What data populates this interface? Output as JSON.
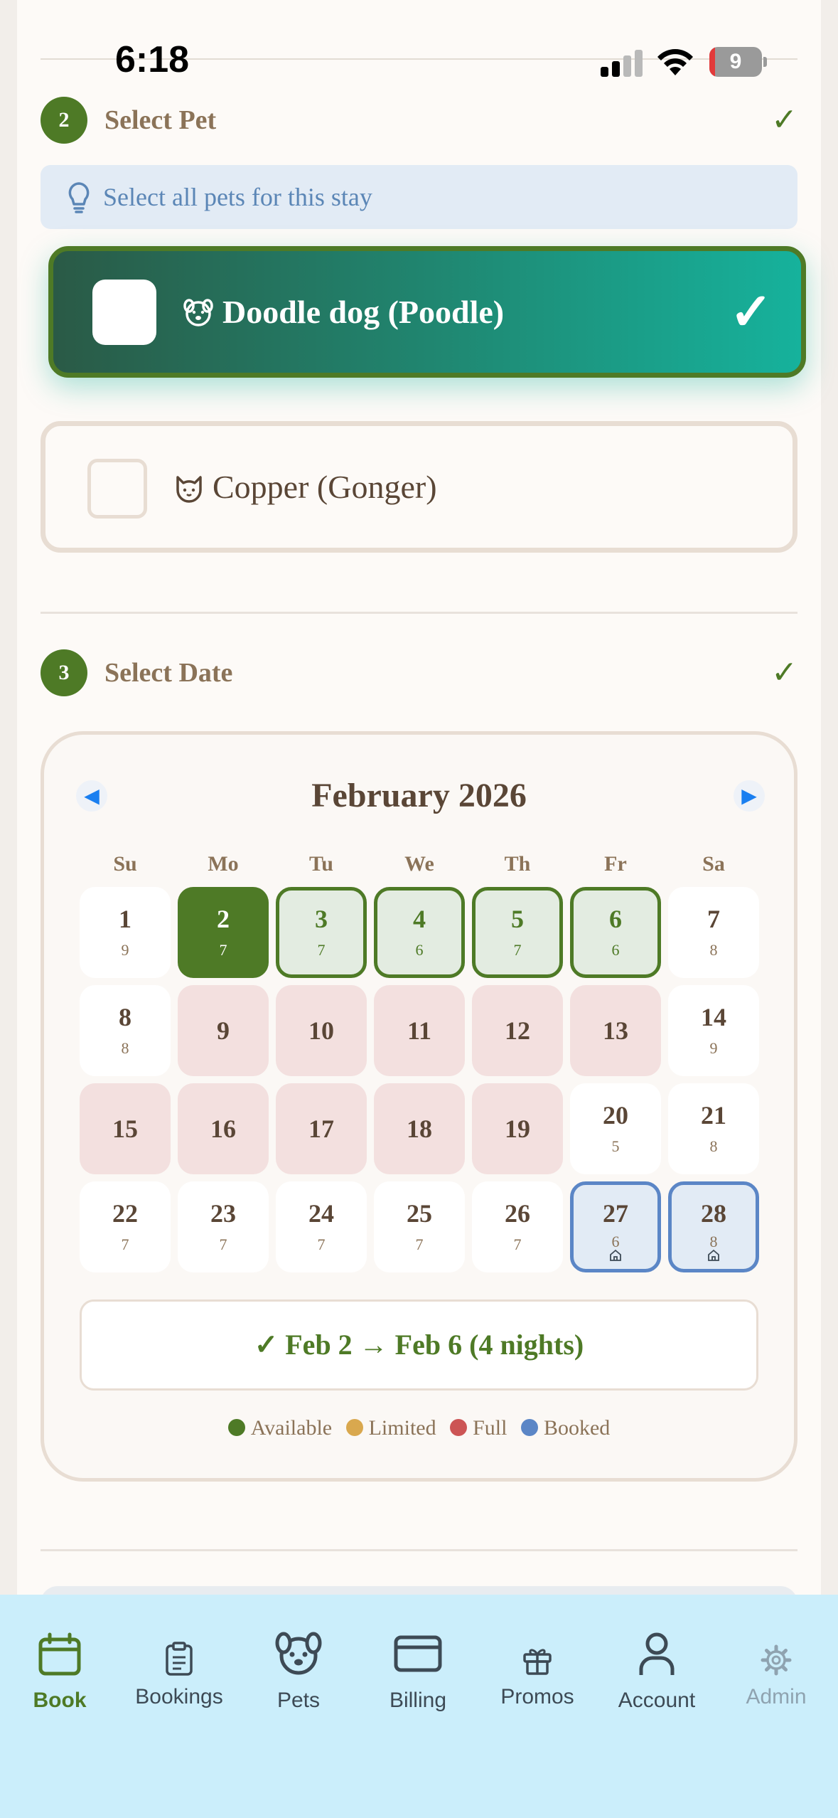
{
  "status_bar": {
    "time": "6:18",
    "battery": "9"
  },
  "pet_section": {
    "step": "2",
    "title": "Select Pet",
    "check": "✓",
    "hint": "Select all pets for this stay",
    "pets": [
      {
        "name": "Doodle dog (Poodle)",
        "kind": "dog-icon",
        "selected": true,
        "tick": "✓"
      },
      {
        "name": "Copper (Gonger)",
        "kind": "cat-icon",
        "selected": false
      }
    ]
  },
  "date_section": {
    "step": "3",
    "title": "Select Date",
    "check": "✓"
  },
  "calendar": {
    "prev": "◀",
    "next": "▶",
    "month": "February 2026",
    "weekdays": [
      "Su",
      "Mo",
      "Tu",
      "We",
      "Th",
      "Fr",
      "Sa"
    ],
    "weeks": [
      [
        {
          "day": "1",
          "count": "9",
          "state": "available"
        },
        {
          "day": "2",
          "count": "7",
          "state": "selected-start"
        },
        {
          "day": "3",
          "count": "7",
          "state": "in-range"
        },
        {
          "day": "4",
          "count": "6",
          "state": "in-range"
        },
        {
          "day": "5",
          "count": "7",
          "state": "in-range"
        },
        {
          "day": "6",
          "count": "6",
          "state": "in-range"
        },
        {
          "day": "7",
          "count": "8",
          "state": "available"
        }
      ],
      [
        {
          "day": "8",
          "count": "8",
          "state": "available"
        },
        {
          "day": "9",
          "count": "",
          "state": "full"
        },
        {
          "day": "10",
          "count": "",
          "state": "full"
        },
        {
          "day": "11",
          "count": "",
          "state": "full"
        },
        {
          "day": "12",
          "count": "",
          "state": "full"
        },
        {
          "day": "13",
          "count": "",
          "state": "full"
        },
        {
          "day": "14",
          "count": "9",
          "state": "available"
        }
      ],
      [
        {
          "day": "15",
          "count": "",
          "state": "full"
        },
        {
          "day": "16",
          "count": "",
          "state": "full"
        },
        {
          "day": "17",
          "count": "",
          "state": "full"
        },
        {
          "day": "18",
          "count": "",
          "state": "full"
        },
        {
          "day": "19",
          "count": "",
          "state": "full"
        },
        {
          "day": "20",
          "count": "5",
          "state": "available"
        },
        {
          "day": "21",
          "count": "8",
          "state": "available"
        }
      ],
      [
        {
          "day": "22",
          "count": "7",
          "state": "available"
        },
        {
          "day": "23",
          "count": "7",
          "state": "available"
        },
        {
          "day": "24",
          "count": "7",
          "state": "available"
        },
        {
          "day": "25",
          "count": "7",
          "state": "available"
        },
        {
          "day": "26",
          "count": "7",
          "state": "available"
        },
        {
          "day": "27",
          "count": "6",
          "state": "booked"
        },
        {
          "day": "28",
          "count": "8",
          "state": "booked"
        }
      ]
    ],
    "range_summary": "✓ Feb 2 → Feb 6 (4 nights)",
    "legend": [
      {
        "label": "Available",
        "color": "#4e7a26"
      },
      {
        "label": "Limited",
        "color": "#d9a84e"
      },
      {
        "label": "Full",
        "color": "#cc5555"
      },
      {
        "label": "Booked",
        "color": "#5b86c6"
      }
    ]
  },
  "tab_bar": {
    "active_color": "#4e7a26",
    "tabs": [
      {
        "label": "Book",
        "icon": "calendar-icon",
        "active": true
      },
      {
        "label": "Bookings",
        "icon": "clipboard-icon",
        "active": false
      },
      {
        "label": "Pets",
        "icon": "dog-icon",
        "active": false
      },
      {
        "label": "Billing",
        "icon": "credit-card-icon",
        "active": false
      },
      {
        "label": "Promos",
        "icon": "gift-icon",
        "active": false
      },
      {
        "label": "Account",
        "icon": "person-icon",
        "active": false
      },
      {
        "label": "Admin",
        "icon": "gear-icon",
        "active": false,
        "muted": true
      }
    ]
  }
}
